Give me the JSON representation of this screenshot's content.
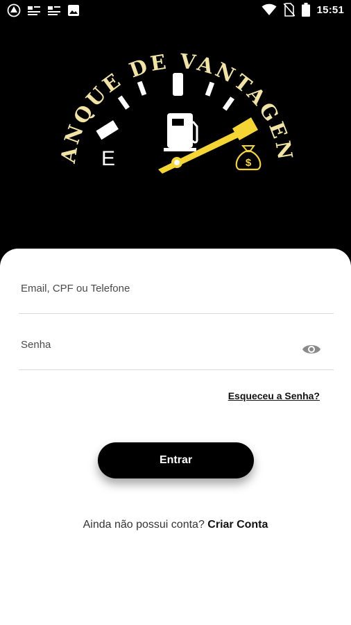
{
  "status_bar": {
    "time": "15:51",
    "left_icons": [
      "app-icon",
      "notification-icon",
      "notification-icon",
      "image-icon"
    ],
    "right_icons": [
      "wifi-icon",
      "no-sim-icon",
      "battery-icon"
    ]
  },
  "logo": {
    "arc_text": "TANQUE DE VANTAGENS",
    "empty_label": "E",
    "fuel_pump_icon": "fuel-pump-icon",
    "money_bag_icon": "money-bag-icon",
    "colors": {
      "gold": "#F5D533",
      "text_gold": "#F1E3A4",
      "white": "#FFFFFF"
    }
  },
  "login": {
    "email_placeholder": "Email, CPF ou Telefone",
    "password_placeholder": "Senha",
    "eye_icon": "eye-icon",
    "forgot_password": "Esqueceu a Senha?",
    "submit_label": "Entrar",
    "signup_prompt": "Ainda não possui conta?",
    "signup_link": "Criar Conta"
  }
}
